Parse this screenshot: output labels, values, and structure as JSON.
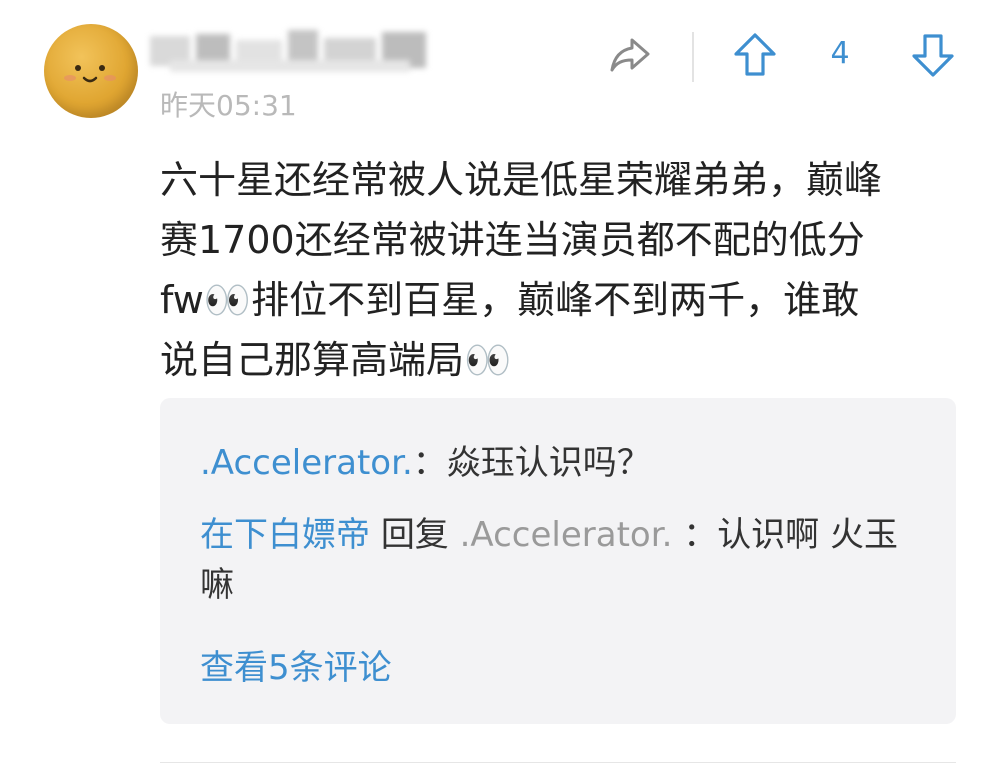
{
  "comment": {
    "timestamp": "昨天05:31",
    "vote_count": "4",
    "body": "六十星还经常被人说是低星荣耀弟弟，巅峰\n赛1700还经常被讲连当演员都不配的低分\nfw👀排位不到百星，巅峰不到两千，谁敢\n说自己那算高端局👀",
    "icons": {
      "share": "share-icon",
      "upvote": "upvote-arrow-icon",
      "downvote": "downvote-arrow-icon"
    }
  },
  "replies": [
    {
      "author": ".Accelerator.",
      "separator": "：",
      "text": "焱珏认识吗？"
    },
    {
      "author": "在下白嫖帝",
      "reply_word": "回复",
      "reply_to": ".Accelerator.",
      "separator": "：",
      "text": "认识啊 火玉嘛"
    }
  ],
  "view_more": "查看5条评论",
  "colors": {
    "accent": "#3e8fd0",
    "text": "#222222",
    "muted": "#9a9a9a",
    "reply_bg": "#f3f3f5"
  }
}
